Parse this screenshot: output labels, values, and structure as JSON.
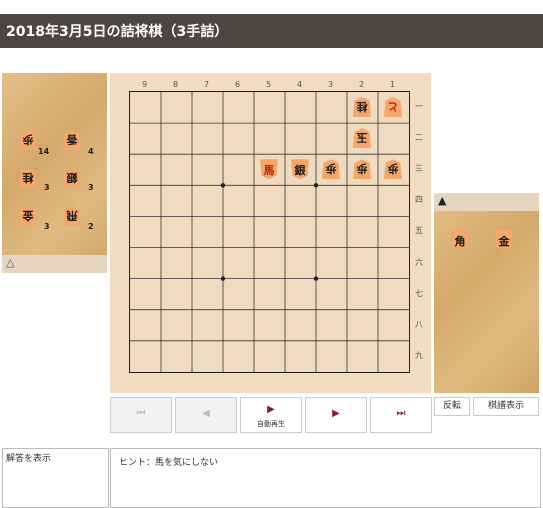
{
  "header": {
    "title": "2018年3月5日の詰将棋（3手詰）"
  },
  "board": {
    "files": [
      "9",
      "8",
      "7",
      "6",
      "5",
      "4",
      "3",
      "2",
      "1"
    ],
    "ranks": [
      "一",
      "二",
      "三",
      "四",
      "五",
      "六",
      "七",
      "八",
      "九"
    ],
    "pieces": [
      {
        "file": 2,
        "rank": 1,
        "char": "桂",
        "side": "gote",
        "promoted": false
      },
      {
        "file": 1,
        "rank": 1,
        "char": "と",
        "side": "gote",
        "promoted": true
      },
      {
        "file": 2,
        "rank": 2,
        "char": "玉",
        "side": "gote",
        "promoted": false
      },
      {
        "file": 5,
        "rank": 3,
        "char": "馬",
        "side": "sente",
        "promoted": true
      },
      {
        "file": 4,
        "rank": 3,
        "char": "銀",
        "side": "sente",
        "promoted": false
      },
      {
        "file": 3,
        "rank": 3,
        "char": "歩",
        "side": "gote",
        "promoted": false
      },
      {
        "file": 2,
        "rank": 3,
        "char": "歩",
        "side": "gote",
        "promoted": false
      },
      {
        "file": 1,
        "rank": 3,
        "char": "歩",
        "side": "gote",
        "promoted": false
      }
    ]
  },
  "gote_hand": {
    "mark": "△",
    "pieces": [
      {
        "char": "歩",
        "count": "14"
      },
      {
        "char": "香",
        "count": "4"
      },
      {
        "char": "桂",
        "count": "3"
      },
      {
        "char": "銀",
        "count": "3"
      },
      {
        "char": "金",
        "count": "3"
      },
      {
        "char": "飛",
        "count": "2"
      }
    ]
  },
  "sente_hand": {
    "mark": "▲",
    "pieces": [
      {
        "char": "角",
        "count": ""
      },
      {
        "char": "金",
        "count": ""
      }
    ]
  },
  "controls": {
    "first": "⏮",
    "prev": "◀",
    "auto": "▶",
    "auto_label": "自動再生",
    "next": "▶",
    "last": "⏭"
  },
  "buttons": {
    "flip": "反転",
    "kifu": "棋譜表示"
  },
  "answer": {
    "label": "解答を表示"
  },
  "hint": {
    "text": "ヒント：馬を気にしない"
  }
}
